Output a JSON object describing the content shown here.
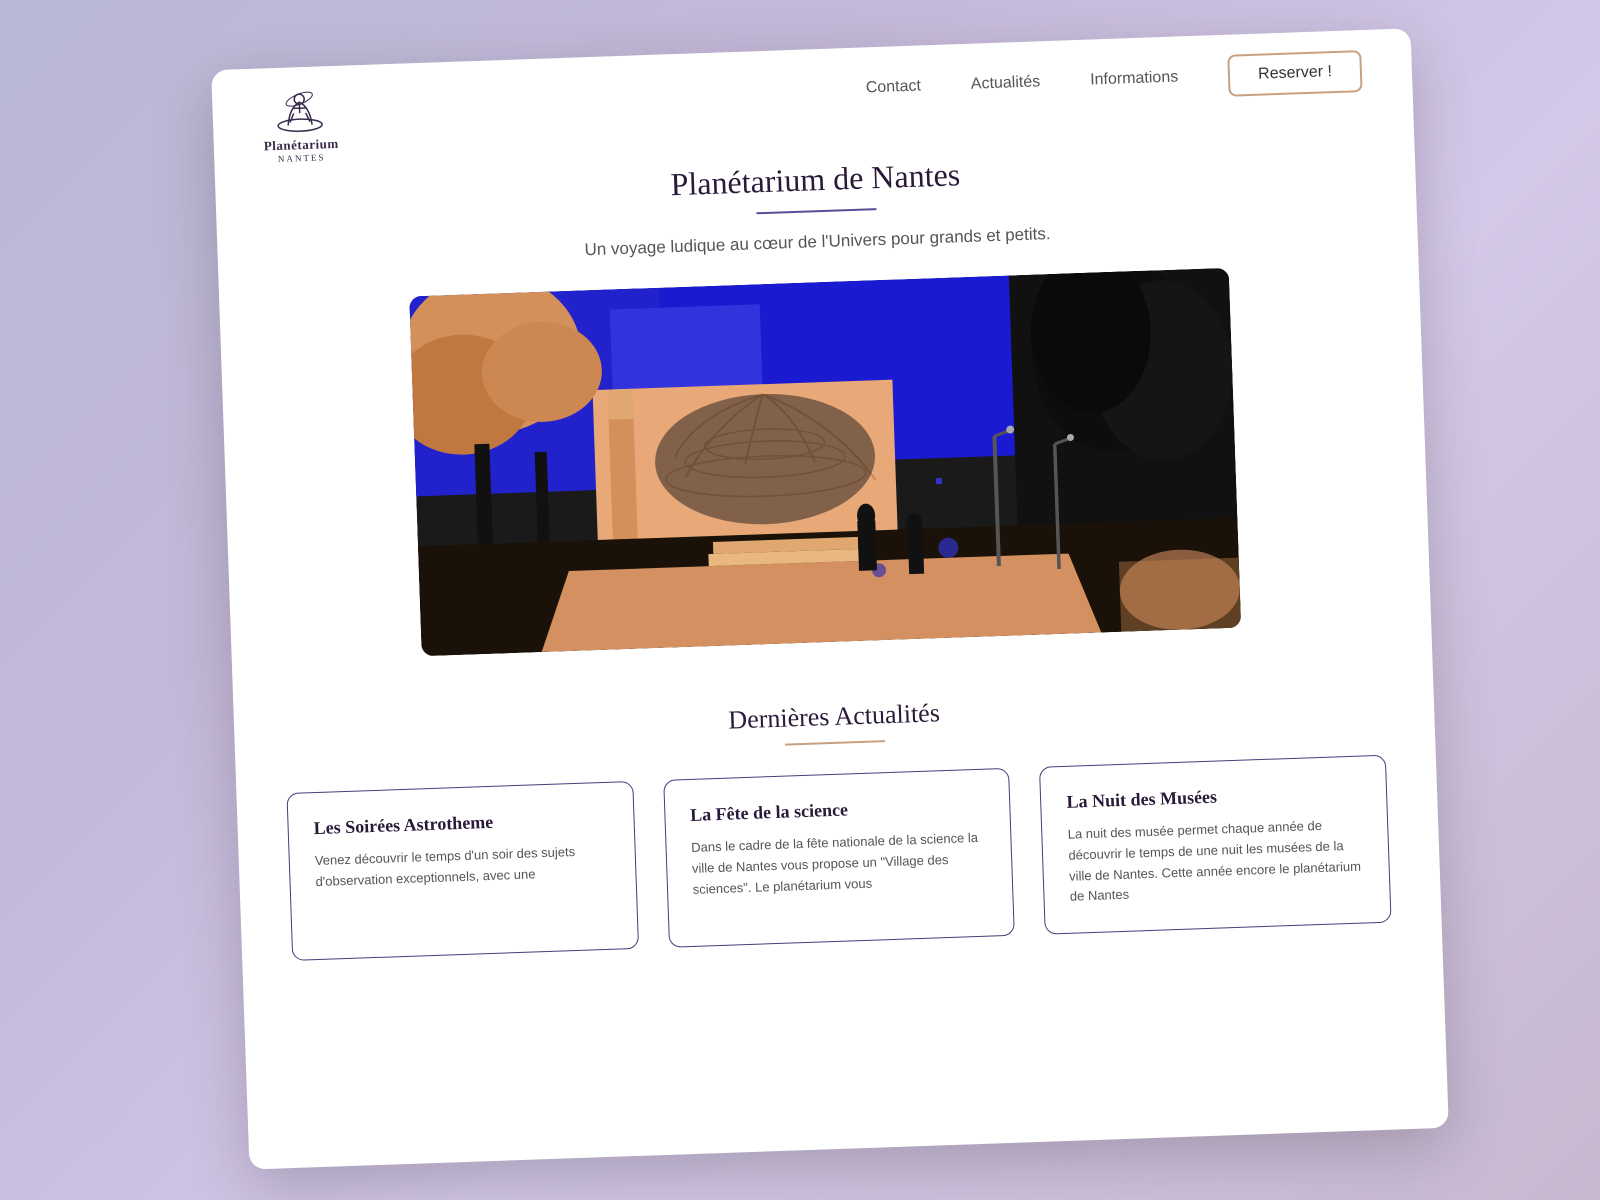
{
  "page": {
    "background": "#b8b8d4"
  },
  "logo": {
    "name": "Planétarium",
    "subtitle": "NANTES"
  },
  "navbar": {
    "links": [
      {
        "label": "Contact",
        "id": "contact"
      },
      {
        "label": "Actualités",
        "id": "actualites"
      },
      {
        "label": "Informations",
        "id": "informations"
      }
    ],
    "reserve_button": "Reserver !"
  },
  "hero": {
    "title": "Planétarium de Nantes",
    "subtitle": "Un voyage ludique au cœur de l'Univers pour grands et petits.",
    "image_alt": "Planetarium building exterior"
  },
  "actualites": {
    "section_title": "Dernières Actualités",
    "cards": [
      {
        "title": "Les Soirées Astrotheme",
        "text": "Venez découvrir le temps d'un soir des sujets d'observation exceptionnels, avec une"
      },
      {
        "title": "La Fête de la science",
        "text": "Dans le cadre de la fête nationale de la science la ville de Nantes vous propose un \"Village des sciences\". Le planétarium vous"
      },
      {
        "title": "La Nuit des Musées",
        "text": "La nuit des musée permet chaque année de découvrir le temps de une nuit les musées de la ville de Nantes. Cette année encore le planétarium de Nantes"
      }
    ]
  }
}
